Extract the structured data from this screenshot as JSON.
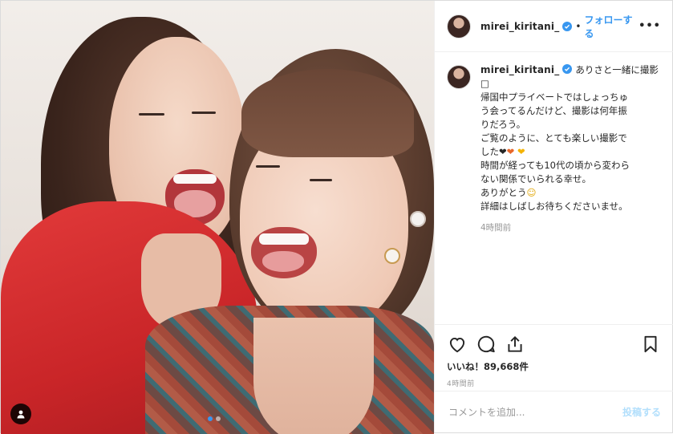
{
  "header": {
    "username": "mirei_kiritani_",
    "separator": "•",
    "follow_label": "フォローする",
    "more_label": "•••"
  },
  "caption": {
    "username": "mirei_kiritani_",
    "lines": [
      "ありさと一緒に撮影",
      "□",
      "帰国中プライベートではしょっちゅ",
      "う会ってるんだけど、撮影は何年振",
      "りだろう。",
      "ご覧のように、とても楽しい撮影で",
      "した",
      "時間が経っても10代の頃から変わら",
      "ない関係でいられる幸せ。",
      "ありがとう",
      "詳細はしばしお待ちくださいませ。"
    ],
    "hearts": [
      "❤",
      "❤",
      "❤"
    ],
    "heart_colors": [
      "#262626",
      "#e8672a",
      "#f4b300"
    ],
    "emoji": "☺",
    "time": "4時間前"
  },
  "actions": {
    "likes": "いいね！89,668件",
    "time": "4時間前"
  },
  "comment": {
    "placeholder": "コメントを追加...",
    "post_label": "投稿する"
  },
  "colors": {
    "accent": "#3897f0",
    "post_disabled": "#b2dffc",
    "shirt_red": "#d0282d"
  },
  "carousel": {
    "count": 2,
    "active": 0
  }
}
